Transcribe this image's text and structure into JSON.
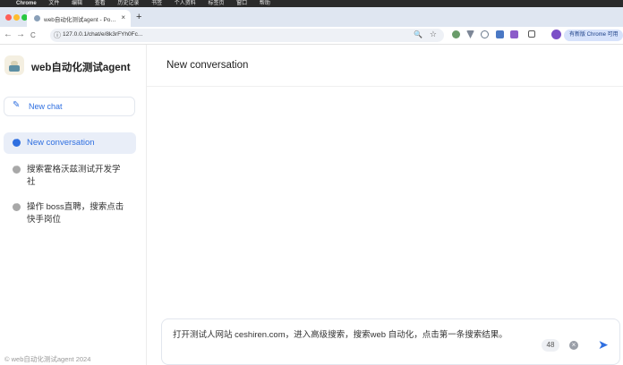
{
  "menubar": {
    "apple": "",
    "items": [
      "Chrome",
      "文件",
      "编辑",
      "查看",
      "历史记录",
      "书签",
      "个人资料",
      "标签页",
      "窗口",
      "帮助"
    ],
    "right_items": [
      "",
      "",
      "",
      "",
      "",
      "",
      "",
      "",
      ""
    ]
  },
  "browser": {
    "tab_title": "web自动化测试agent - Powered",
    "tab_close": "×",
    "new_tab": "+",
    "back": "←",
    "forward": "→",
    "reload": "C",
    "url": "127.0.0.1/chat/e/8k3rFYh0Fc...",
    "zoom_icon": "🔍",
    "star_icon": "☆",
    "update_label": "有新版 Chrome 可用",
    "colors": {
      "tabstrip": "#dfe6f1",
      "close": "#ff5f57",
      "minimize": "#febc2e",
      "maximize": "#28c840"
    }
  },
  "sidebar": {
    "brand": "web自动化测试agent",
    "new_chat_label": "New chat",
    "new_chat_icon": "✎",
    "conversations": [
      {
        "label": "New conversation",
        "active": true
      },
      {
        "label": "搜索霍格沃兹测试开发学社",
        "active": false
      },
      {
        "label": "操作 boss直聘，搜索点击快手岗位",
        "active": false
      }
    ],
    "footer": "© web自动化测试agent 2024"
  },
  "main": {
    "title": "New conversation",
    "composer": {
      "text": "打开测试人网站 ceshiren.com，进入高级搜索，搜索web 自动化，点击第一条搜索结果。",
      "char_count": "48",
      "clear_icon": "×",
      "send_icon": "➤"
    },
    "accent_color": "#2f6fe0"
  }
}
